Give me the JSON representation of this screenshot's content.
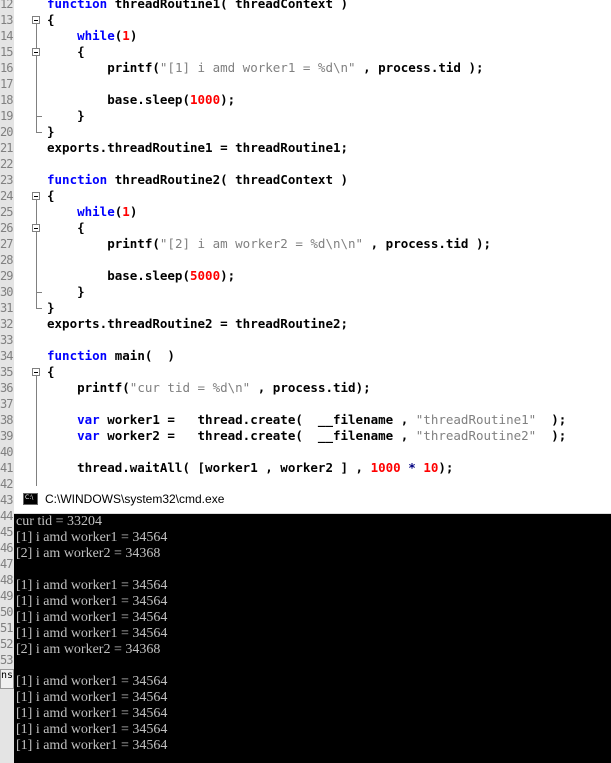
{
  "editor": {
    "lines": [
      {
        "n": "12",
        "html": "<span class='kw'>function</span> threadRoutine1( threadContext )"
      },
      {
        "n": "13",
        "html": "{"
      },
      {
        "n": "14",
        "html": "    <span class='kw'>while</span>(<span class='num'>1</span>)"
      },
      {
        "n": "15",
        "html": "    {"
      },
      {
        "n": "16",
        "html": "        printf(<span class='str'>\"[1] i amd worker1 = %d\\n\"</span> , process.tid );"
      },
      {
        "n": "17",
        "html": ""
      },
      {
        "n": "18",
        "html": "        base.sleep(<span class='num'>1000</span>);"
      },
      {
        "n": "19",
        "html": "    }"
      },
      {
        "n": "20",
        "html": "}"
      },
      {
        "n": "21",
        "html": "exports.threadRoutine1 = threadRoutine1;"
      },
      {
        "n": "22",
        "html": ""
      },
      {
        "n": "23",
        "html": "<span class='kw'>function</span> threadRoutine2( threadContext )"
      },
      {
        "n": "24",
        "html": "{"
      },
      {
        "n": "25",
        "html": "    <span class='kw'>while</span>(<span class='num'>1</span>)"
      },
      {
        "n": "26",
        "html": "    {"
      },
      {
        "n": "27",
        "html": "        printf(<span class='str'>\"[2] i am worker2 = %d\\n\\n\"</span> , process.tid );"
      },
      {
        "n": "28",
        "html": ""
      },
      {
        "n": "29",
        "html": "        base.sleep(<span class='num'>5000</span>);"
      },
      {
        "n": "30",
        "html": "    }"
      },
      {
        "n": "31",
        "html": "}"
      },
      {
        "n": "32",
        "html": "exports.threadRoutine2 = threadRoutine2;"
      },
      {
        "n": "33",
        "html": ""
      },
      {
        "n": "34",
        "html": "<span class='kw'>function</span> main(  )"
      },
      {
        "n": "35",
        "html": "{"
      },
      {
        "n": "36",
        "html": "    printf(<span class='str'>\"cur tid = %d\\n\"</span> , process.tid);"
      },
      {
        "n": "37",
        "html": ""
      },
      {
        "n": "38",
        "html": "    <span class='kw'>var</span> worker1 =   thread.create(  __filename , <span class='str'>\"threadRoutine1\"</span>  );"
      },
      {
        "n": "39",
        "html": "    <span class='kw'>var</span> worker2 =   thread.create(  __filename , <span class='str'>\"threadRoutine2\"</span>  );"
      },
      {
        "n": "40",
        "html": ""
      },
      {
        "n": "41",
        "html": "    thread.waitAll( [worker1 , worker2 ] , <span class='num'>1000</span> <span class='op'>*</span> <span class='num'>10</span>);"
      }
    ],
    "hidden_line_numbers": [
      "42",
      "43",
      "44",
      "45",
      "46",
      "47",
      "48",
      "49",
      "50",
      "51",
      "52",
      "53"
    ]
  },
  "cmd": {
    "title": "C:\\WINDOWS\\system32\\cmd.exe",
    "icon_text": "C:\\",
    "output": [
      "cur tid = 33204",
      "[1] i amd worker1 = 34564",
      "[2] i am worker2 = 34368",
      "",
      "[1] i amd worker1 = 34564",
      "[1] i amd worker1 = 34564",
      "[1] i amd worker1 = 34564",
      "[1] i amd worker1 = 34564",
      "[2] i am worker2 = 34368",
      "",
      "[1] i amd worker1 = 34564",
      "[1] i amd worker1 = 34564",
      "[1] i amd worker1 = 34564",
      "[1] i amd worker1 = 34564",
      "[1] i amd worker1 = 34564"
    ]
  },
  "side_tab_text": "nso"
}
